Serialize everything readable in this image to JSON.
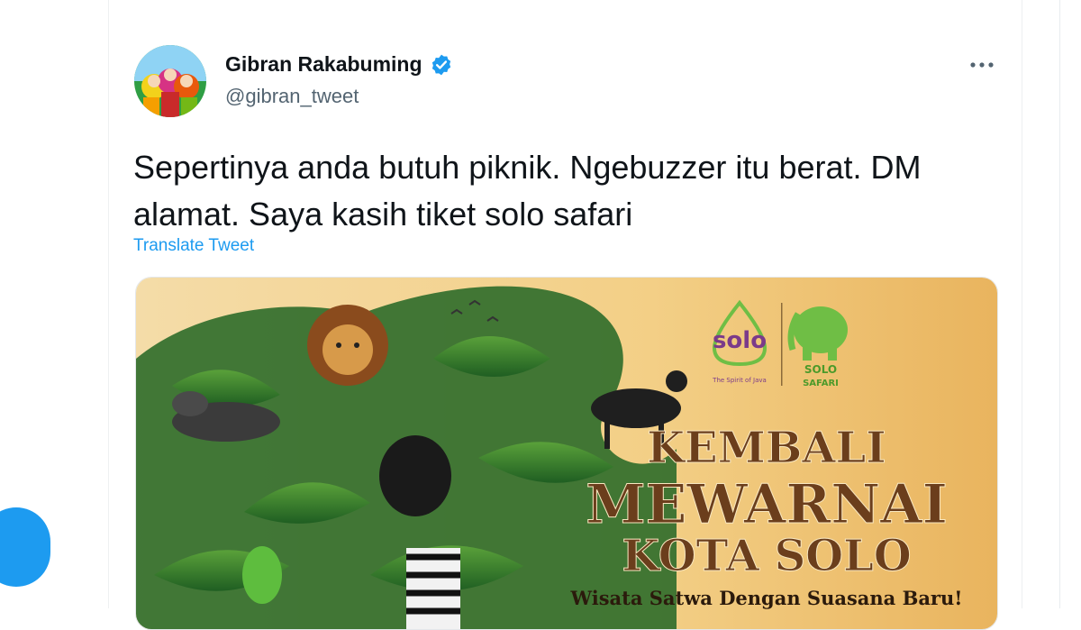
{
  "tweet": {
    "author_name": "Gibran Rakabuming",
    "handle": "@gibran_tweet",
    "text": "Sepertinya anda butuh piknik. Ngebuzzer itu berat. DM alamat. Saya kasih tiket solo safari",
    "translate_label": "Translate Tweet",
    "more_icon": "more-horizontal-icon",
    "verified_icon": "verified-badge-icon"
  },
  "media": {
    "logo_solo_text": "solo",
    "logo_solo_tagline": "The Spirit of Java",
    "logo_safari_line1": "SOLO",
    "logo_safari_line2": "SAFARI",
    "headline_line1": "KEMBALI",
    "headline_line2": "MEWARNAI",
    "headline_line3": "KOTA SOLO",
    "subheadline": "Wisata Satwa Dengan Suasana Baru!"
  },
  "colors": {
    "accent": "#1d9bf0",
    "text_primary": "#0f1419",
    "text_secondary": "#536471",
    "banner_bg": "#f3cf86",
    "headline_brown": "#6b3e1c",
    "logo_purple": "#7b3a8a",
    "logo_green": "#6fbe45"
  }
}
